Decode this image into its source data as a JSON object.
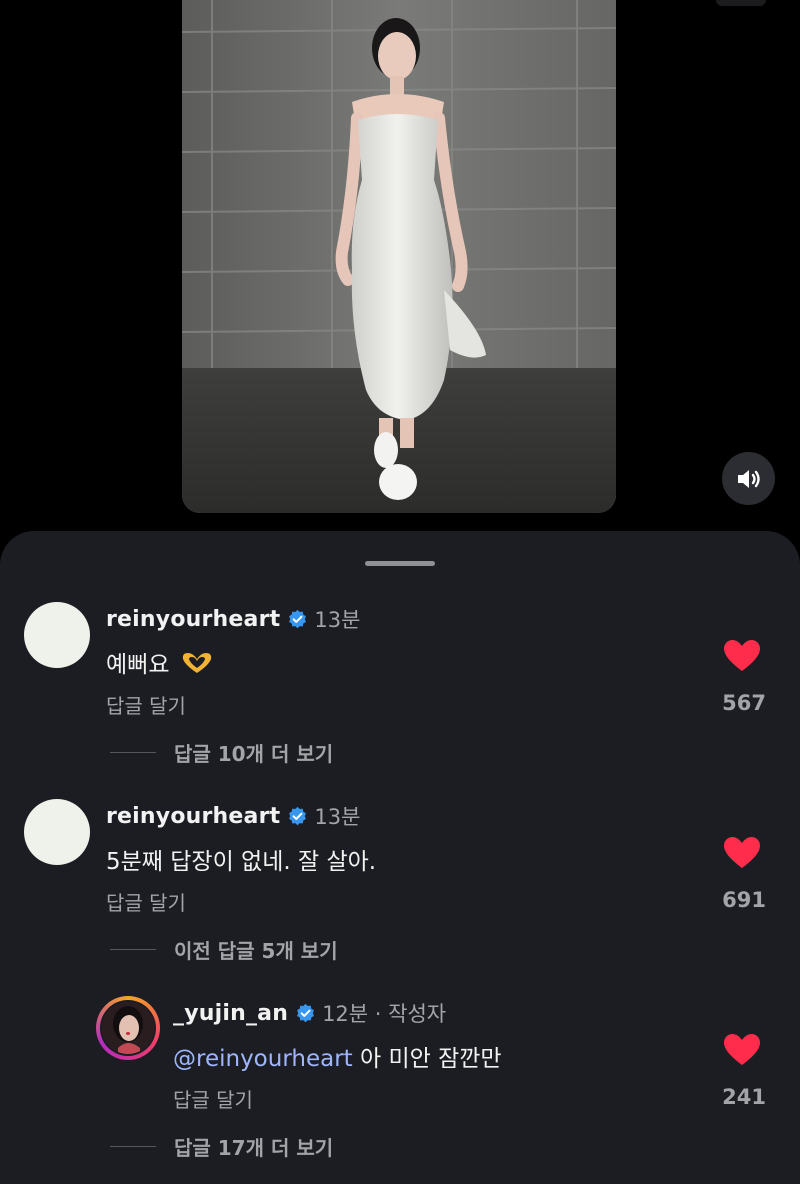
{
  "post": {
    "sound_icon": "speaker-icon",
    "colors": {
      "background": "#000000",
      "sheet": "#1b1d22",
      "like": "#ff2d4b",
      "verified": "#3797f0",
      "mention": "#9fb6ff"
    }
  },
  "comments": [
    {
      "username": "reinyourheart",
      "verified": true,
      "time": "13분",
      "text": "예뻐요",
      "emoji": "heart-hands",
      "reply_label": "답글 달기",
      "likes": "567",
      "view_replies": "답글 10개 더 보기"
    },
    {
      "username": "reinyourheart",
      "verified": true,
      "time": "13분",
      "text": "5분째 답장이 없네. 잘 살아.",
      "reply_label": "답글 달기",
      "likes": "691",
      "view_replies": "이전 답글 5개 보기"
    }
  ],
  "reply": {
    "username": "_yujin_an",
    "verified": true,
    "time": "12분 · 작성자",
    "mention": "@reinyourheart",
    "text": " 아 미안 잠깐만",
    "reply_label": "답글 달기",
    "likes": "241",
    "view_replies": "답글 17개 더 보기"
  }
}
